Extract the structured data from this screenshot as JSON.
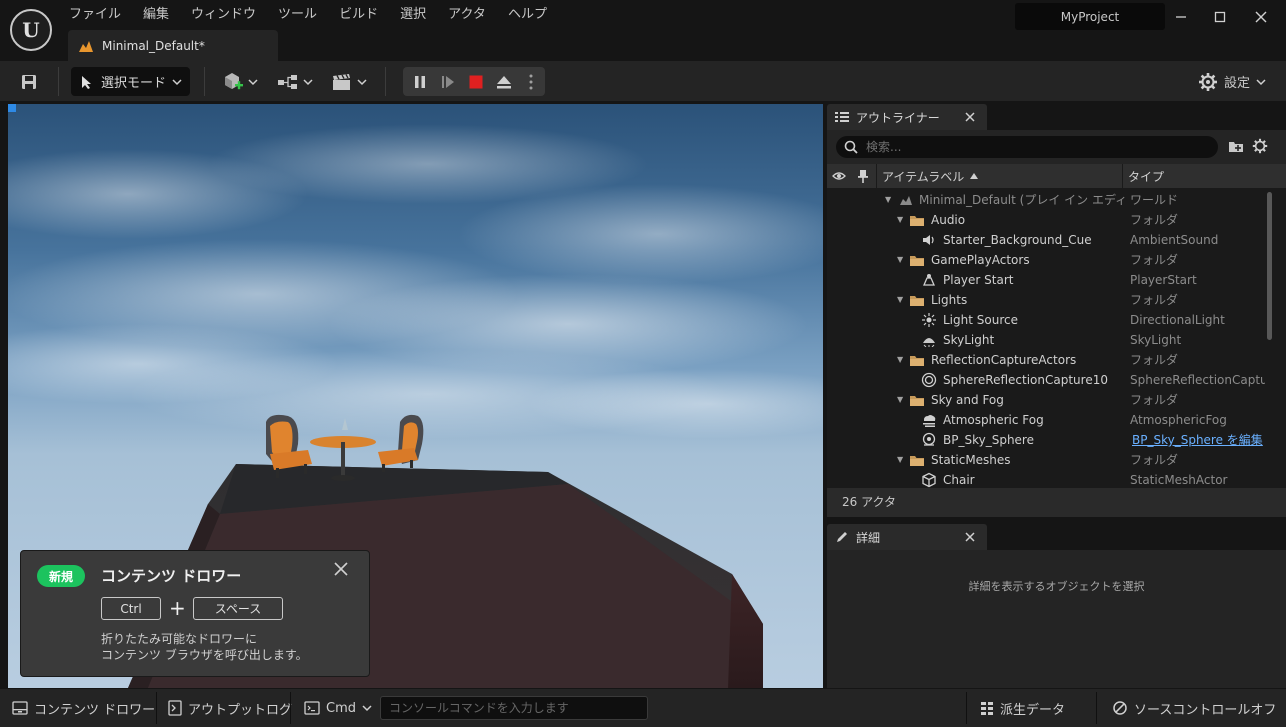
{
  "menu": [
    "ファイル",
    "編集",
    "ウィンドウ",
    "ツール",
    "ビルド",
    "選択",
    "アクタ",
    "ヘルプ"
  ],
  "project_name": "MyProject",
  "level_tab": "Minimal_Default*",
  "toolbar": {
    "mode_label": "選択モード",
    "settings_label": "設定"
  },
  "drawer_popup": {
    "badge": "新規",
    "title": "コンテンツ ドロワー",
    "key1": "Ctrl",
    "plus": "+",
    "key2": "スペース",
    "desc_line1": "折りたたみ可能なドロワーに",
    "desc_line2": "コンテンツ ブラウザを呼び出します。"
  },
  "outliner": {
    "tab_label": "アウトライナー",
    "search_placeholder": "検索...",
    "col_label": "アイテムラベル",
    "col_type": "タイプ",
    "rows": [
      {
        "label": "Minimal_Default (プレイ イン エディタ)",
        "type": "ワールド",
        "icon": "level-icon",
        "expanded": true
      },
      {
        "label": "Audio",
        "type": "フォルダ",
        "icon": "folder-icon",
        "expanded": true
      },
      {
        "label": "Starter_Background_Cue",
        "type": "AmbientSound",
        "icon": "speaker-icon"
      },
      {
        "label": "GamePlayActors",
        "type": "フォルダ",
        "icon": "folder-icon",
        "expanded": true
      },
      {
        "label": "Player Start",
        "type": "PlayerStart",
        "icon": "player-start-icon"
      },
      {
        "label": "Lights",
        "type": "フォルダ",
        "icon": "folder-icon",
        "expanded": true
      },
      {
        "label": "Light Source",
        "type": "DirectionalLight",
        "icon": "sun-icon"
      },
      {
        "label": "SkyLight",
        "type": "SkyLight",
        "icon": "skylight-icon"
      },
      {
        "label": "ReflectionCaptureActors",
        "type": "フォルダ",
        "icon": "folder-icon",
        "expanded": true
      },
      {
        "label": "SphereReflectionCapture10",
        "type": "SphereReflectionCapture",
        "icon": "sphere-capture-icon"
      },
      {
        "label": "Sky and Fog",
        "type": "フォルダ",
        "icon": "folder-icon",
        "expanded": true
      },
      {
        "label": "Atmospheric Fog",
        "type": "AtmosphericFog",
        "icon": "fog-icon"
      },
      {
        "label": "BP_Sky_Sphere",
        "type": "BP_Sky_Sphere を編集",
        "icon": "sky-sphere-icon",
        "link": true
      },
      {
        "label": "StaticMeshes",
        "type": "フォルダ",
        "icon": "folder-icon",
        "expanded": true
      },
      {
        "label": "Chair",
        "type": "StaticMeshActor",
        "icon": "cube-icon"
      }
    ],
    "actor_count": "26 アクタ"
  },
  "details": {
    "tab_label": "詳細",
    "empty_text": "詳細を表示するオブジェクトを選択"
  },
  "statusbar": {
    "content_drawer": "コンテンツ ドロワー",
    "output_log": "アウトプットログ",
    "cmd": "Cmd",
    "console_placeholder": "コンソールコマンドを入力します",
    "derived_data": "派生データ",
    "source_control": "ソースコントロールオフ"
  },
  "colors": {
    "accent": "#2e8ae6",
    "new_badge": "#1cc35e",
    "stop_red": "#e02020",
    "folder": "#c79a5a",
    "link": "#6ab0ff"
  }
}
